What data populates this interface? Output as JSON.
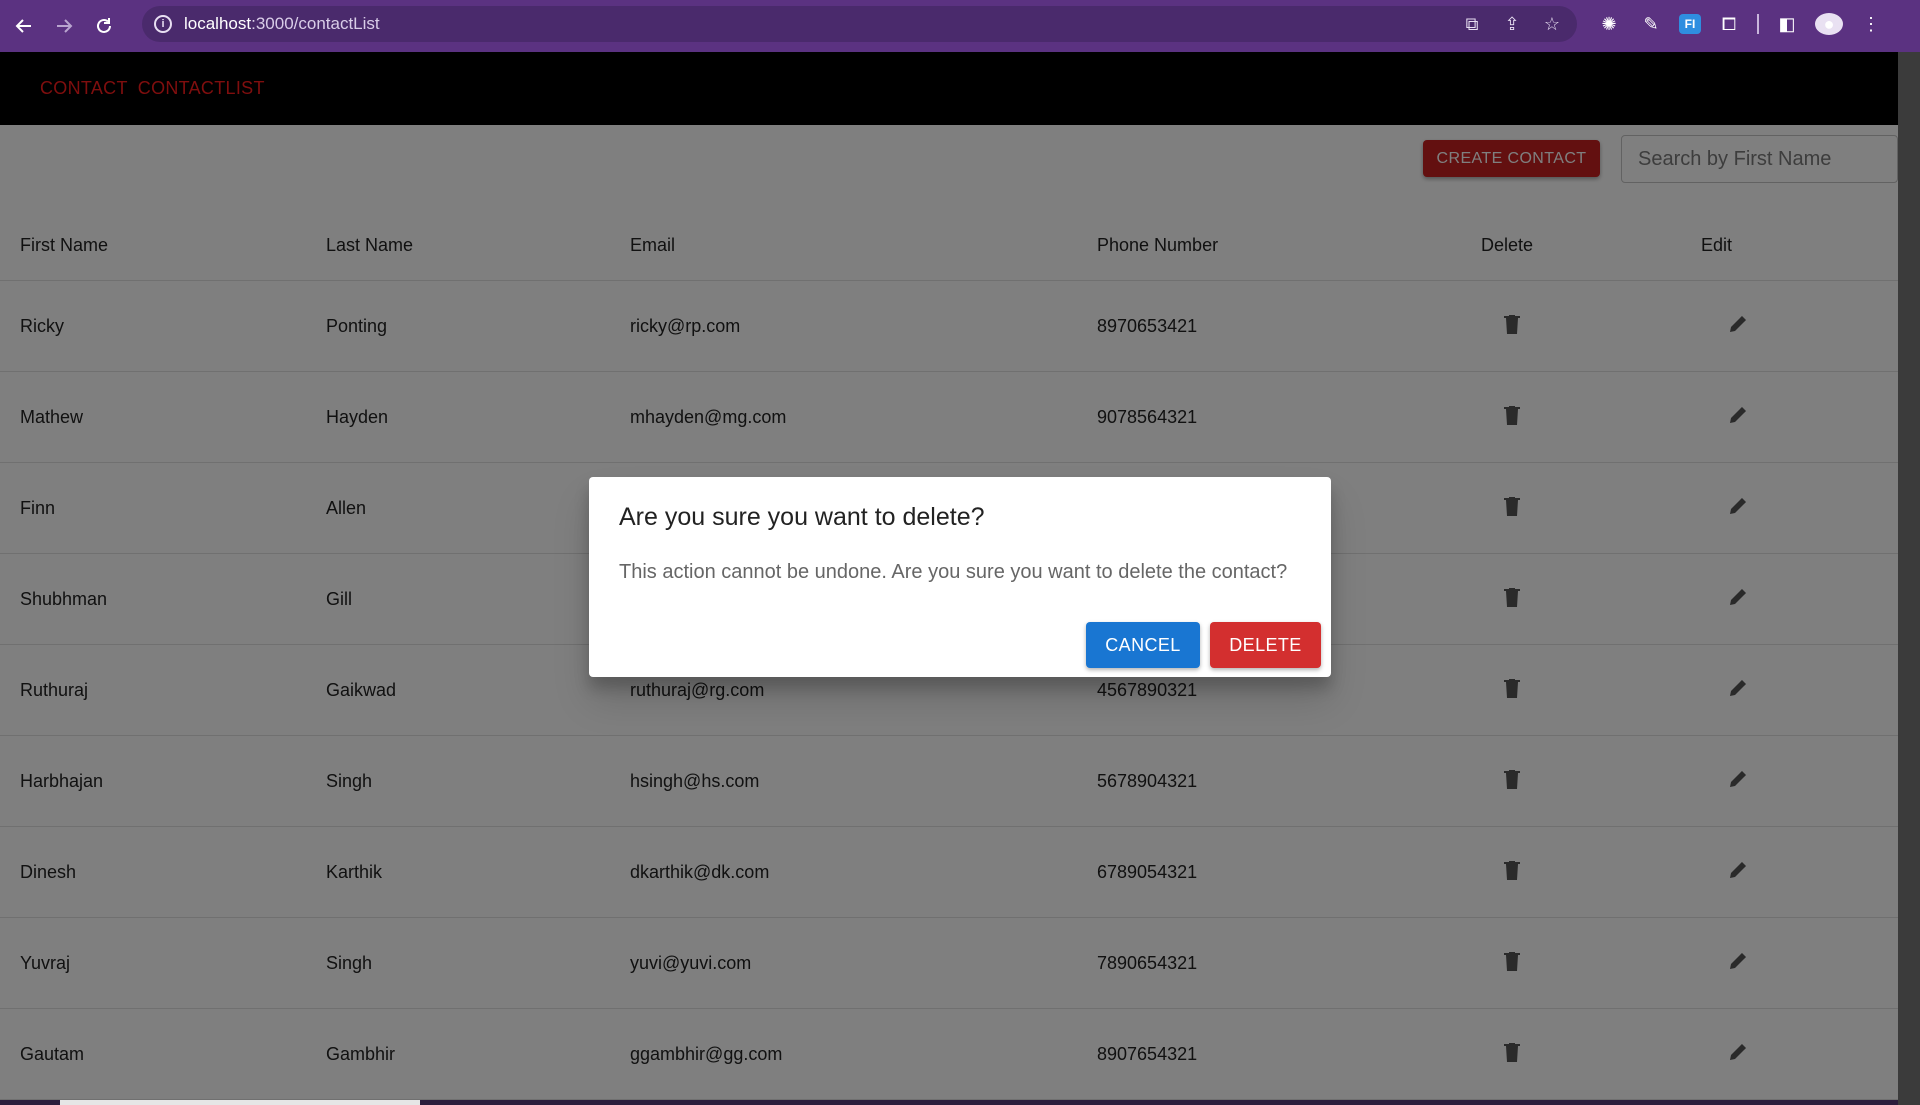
{
  "browser": {
    "url_host": "localhost",
    "url_path": ":3000/contactList"
  },
  "nav": {
    "contact_link": "CONTACT",
    "contactlist_link": "CONTACTLIST"
  },
  "toolbar": {
    "create_label": "CREATE CONTACT",
    "search_placeholder": "Search by First Name"
  },
  "table": {
    "headers": [
      "First Name",
      "Last Name",
      "Email",
      "Phone Number",
      "Delete",
      "Edit"
    ],
    "rows": [
      {
        "first": "Ricky",
        "last": "Ponting",
        "email": "ricky@rp.com",
        "phone": "8970653421"
      },
      {
        "first": "Mathew",
        "last": "Hayden",
        "email": "mhayden@mg.com",
        "phone": "9078564321"
      },
      {
        "first": "Finn",
        "last": "Allen",
        "email": "",
        "phone": ""
      },
      {
        "first": "Shubhman",
        "last": "Gill",
        "email": "",
        "phone": ""
      },
      {
        "first": "Ruthuraj",
        "last": "Gaikwad",
        "email": "ruthuraj@rg.com",
        "phone": "4567890321"
      },
      {
        "first": "Harbhajan",
        "last": "Singh",
        "email": "hsingh@hs.com",
        "phone": "5678904321"
      },
      {
        "first": "Dinesh",
        "last": "Karthik",
        "email": "dkarthik@dk.com",
        "phone": "6789054321"
      },
      {
        "first": "Yuvraj",
        "last": "Singh",
        "email": "yuvi@yuvi.com",
        "phone": "7890654321"
      },
      {
        "first": "Gautam",
        "last": "Gambhir",
        "email": "ggambhir@gg.com",
        "phone": "8907654321"
      }
    ]
  },
  "dialog": {
    "title": "Are you sure you want to delete?",
    "message": "This action cannot be undone. Are you sure you want to delete the contact?",
    "cancel_label": "CANCEL",
    "delete_label": "DELETE"
  },
  "colors": {
    "browser_frame": "#5b3281",
    "appbar": "#000000",
    "nav_link": "#ff1c1c",
    "create_button": "#c62020",
    "cancel_button": "#1976d2",
    "delete_button": "#d32f2f"
  },
  "icons": {
    "back": "arrow-left-icon",
    "forward": "arrow-right-icon",
    "reload": "reload-icon",
    "delete_row": "trash-icon",
    "edit_row": "pencil-icon"
  }
}
